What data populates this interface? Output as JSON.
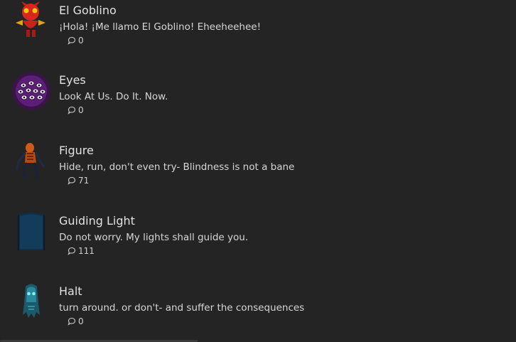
{
  "items": [
    {
      "name": "El Goblino",
      "description": "¡Hola! ¡Me llamo El Goblino! Eheeheehee!",
      "comments": "0",
      "avatar_icon": "red-goblin-icon"
    },
    {
      "name": "Eyes",
      "description": "Look At Us. Do It. Now.",
      "comments": "0",
      "avatar_icon": "purple-eyes-icon"
    },
    {
      "name": "Figure",
      "description": "Hide, run, don't even try- Blindness is not a bane",
      "comments": "71",
      "avatar_icon": "figure-creature-icon"
    },
    {
      "name": "Guiding Light",
      "description": "Do not worry. My lights shall guide you.",
      "comments": "111",
      "avatar_icon": "blue-door-icon"
    },
    {
      "name": "Halt",
      "description": "turn around. or don't- and suffer the consequences",
      "comments": "0",
      "avatar_icon": "cyan-ghost-icon"
    }
  ]
}
